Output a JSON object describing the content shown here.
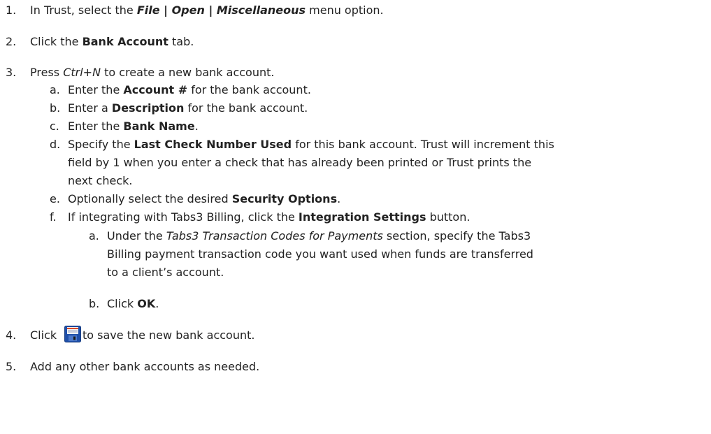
{
  "steps": {
    "s1": {
      "num": "1.",
      "pre": "In Trust, select the ",
      "menu": "File | Open | Miscellaneous",
      "post": " menu option."
    },
    "s2": {
      "num": "2.",
      "pre": "Click the ",
      "bold": "Bank Account",
      "post": " tab."
    },
    "s3": {
      "num": "3.",
      "pre": "Press ",
      "ital": "Ctrl+N",
      "post": " to create a new bank account."
    },
    "s3a": {
      "num": "a.",
      "pre": "Enter the ",
      "bold": "Account #",
      "post": " for the bank account."
    },
    "s3b": {
      "num": "b.",
      "pre": "Enter a ",
      "bold": "Description",
      "post": " for the bank account."
    },
    "s3c": {
      "num": "c.",
      "pre": "Enter the ",
      "bold": "Bank Name",
      "post": "."
    },
    "s3d": {
      "num": "d.",
      "pre": "Specify the ",
      "bold": "Last Check Number Used",
      "post1": " for this bank account. Trust will increment this",
      "line2": "field by 1 when you enter a check that has already been printed or Trust prints the",
      "line3": "next check."
    },
    "s3e": {
      "num": "e.",
      "pre": "Optionally select the desired ",
      "bold": "Security Options",
      "post": "."
    },
    "s3f": {
      "num": "f.",
      "pre": "If integrating with Tabs3 Billing, click the ",
      "bold": "Integration Settings",
      "post": " button."
    },
    "s3fa": {
      "num": "a.",
      "pre": "Under the ",
      "ital": "Tabs3 Transaction Codes for Payments",
      "post": " section, specify the Tabs3",
      "line2": "Billing payment transaction code you want used when funds are transferred",
      "line3": "to a client’s account."
    },
    "s3fb": {
      "num": "b.",
      "pre": "Click ",
      "bold": "OK",
      "post": "."
    },
    "s4": {
      "num": "4.",
      "pre": "Click ",
      "post": "to save the new bank account."
    },
    "s5": {
      "num": "5.",
      "text": "Add any other bank accounts as needed."
    }
  },
  "icons": {
    "save": "save-floppy-icon"
  }
}
